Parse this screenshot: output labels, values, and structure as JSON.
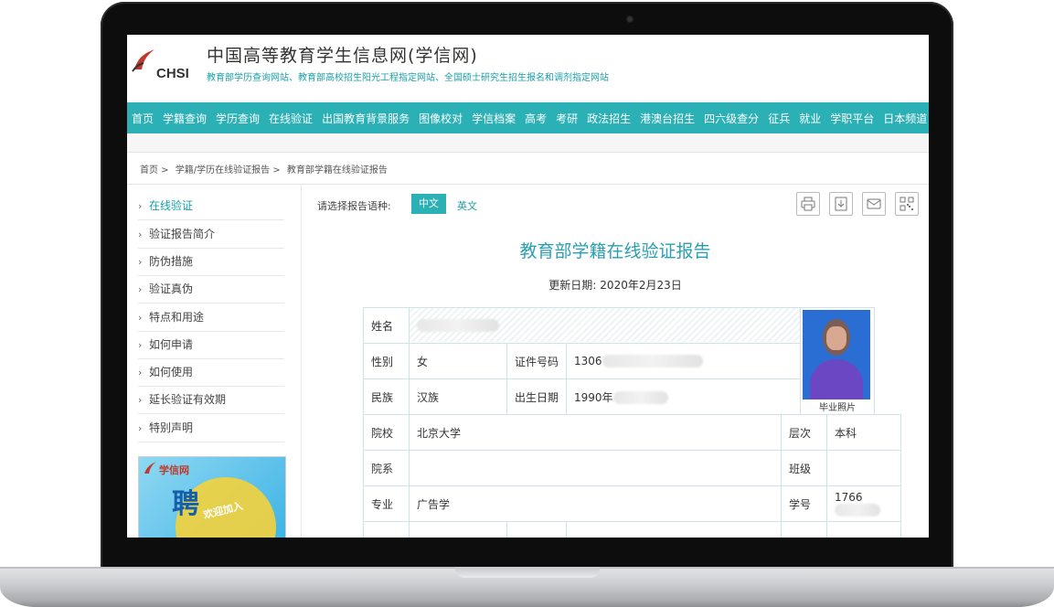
{
  "site": {
    "logo_text": "CHSI",
    "title": "中国高等教育学生信息网(学信网)",
    "subtitle": "教育部学历查询网站、教育部高校招生阳光工程指定网站、全国硕士研究生招生报名和调剂指定网站"
  },
  "nav": [
    "首页",
    "学籍查询",
    "学历查询",
    "在线验证",
    "出国教育背景服务",
    "图像校对",
    "学信档案",
    "高考",
    "考研",
    "政法招生",
    "港澳台招生",
    "四六级查分",
    "征兵",
    "就业",
    "学职平台",
    "日本频道"
  ],
  "breadcrumb": [
    "首页 >",
    "学籍/学历在线验证报告 >",
    "教育部学籍在线验证报告"
  ],
  "sidebar": {
    "items": [
      "在线验证",
      "验证报告简介",
      "防伪措施",
      "验证真伪",
      "特点和用途",
      "如何申请",
      "如何使用",
      "延长验证有效期",
      "特别声明"
    ],
    "ad_brand": "学信网",
    "ad_big": "聘",
    "ad_small": "欢迎加入"
  },
  "report": {
    "language_label": "请选择报告语种:",
    "lang_zh": "中文",
    "lang_en": "英文",
    "tools": [
      "print-icon",
      "download-icon",
      "mail-icon",
      "qrcode-icon"
    ],
    "title": "教育部学籍在线验证报告",
    "update_label": "更新日期:",
    "update_date": "2020年2月23日",
    "photo_caption": "毕业照片",
    "fields": {
      "name_label": "姓名",
      "gender_label": "性别",
      "gender": "女",
      "id_label": "证件号码",
      "id_prefix": "1306",
      "ethnicity_label": "民族",
      "ethnicity": "汉族",
      "birth_label": "出生日期",
      "birth_prefix": "1990年",
      "school_label": "院校",
      "school": "北京大学",
      "level_label": "层次",
      "level": "本科",
      "dept_label": "院系",
      "dept": "",
      "class_label": "班级",
      "class": "",
      "major_label": "专业",
      "major": "广告学",
      "student_no_label": "学号",
      "student_no_prefix": "1766"
    }
  }
}
